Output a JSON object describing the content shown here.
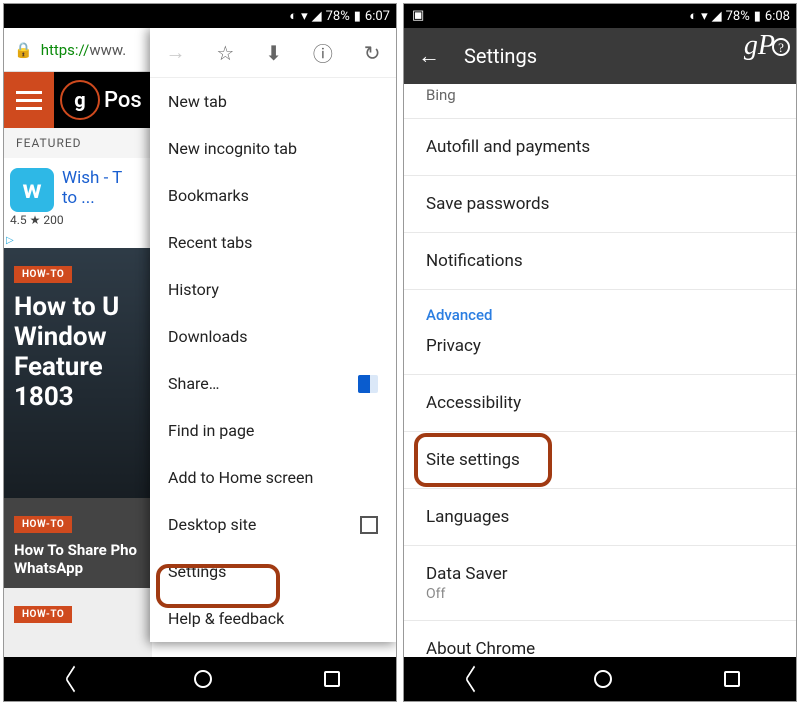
{
  "left": {
    "status": {
      "battery": "78%",
      "time": "6:07"
    },
    "url": {
      "scheme": "https://",
      "host": "www."
    },
    "site": {
      "logo_text": "Pos",
      "featured": "FEATURED",
      "ad": {
        "title": "Wish - T",
        "title2": "to ...",
        "rating": "4.5",
        "reviews": "200"
      },
      "article1": {
        "tag": "HOW-TO",
        "title": "How to U\nWindow\nFeature \n1803"
      },
      "article2": {
        "tag": "HOW-TO",
        "title": "How To Share Pho\nWhatsApp"
      },
      "article3": {
        "tag": "HOW-TO"
      }
    },
    "menu": {
      "items": [
        "New tab",
        "New incognito tab",
        "Bookmarks",
        "Recent tabs",
        "History",
        "Downloads",
        "Share…",
        "Find in page",
        "Add to Home screen",
        "Desktop site",
        "Settings",
        "Help & feedback"
      ]
    }
  },
  "right": {
    "status": {
      "battery": "78%",
      "time": "6:08"
    },
    "header": "Settings",
    "partial_top": "Bing",
    "items": [
      "Autofill and payments",
      "Save passwords",
      "Notifications"
    ],
    "section": "Advanced",
    "advanced": [
      "Privacy",
      "Accessibility",
      "Site settings",
      "Languages"
    ],
    "datasaver": {
      "label": "Data Saver",
      "sub": "Off"
    },
    "about": "About Chrome"
  }
}
